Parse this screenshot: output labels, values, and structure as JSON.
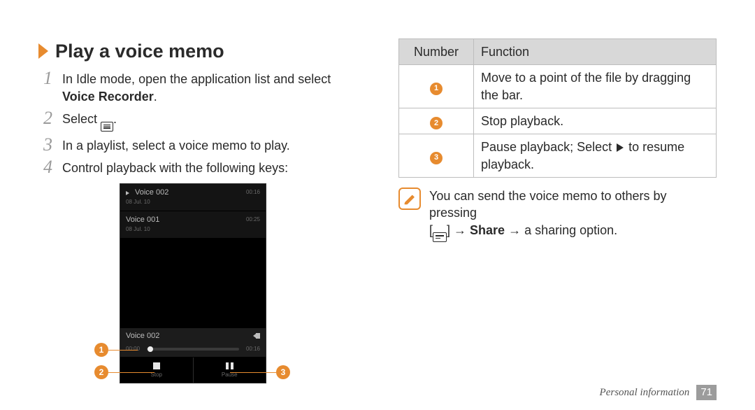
{
  "heading": "Play a voice memo",
  "steps": {
    "s1": {
      "num": "1",
      "pre": "In Idle mode, open the application list and select ",
      "bold": "Voice Recorder",
      "post": "."
    },
    "s2": {
      "num": "2",
      "pre": "Select ",
      "post": "."
    },
    "s3": {
      "num": "3",
      "text": "In a playlist, select a voice memo to play."
    },
    "s4": {
      "num": "4",
      "text": "Control playback with the following keys:"
    }
  },
  "phone": {
    "items": [
      {
        "title": "Voice 002",
        "date": "08 Jul. 10",
        "dur": "00:16"
      },
      {
        "title": "Voice 001",
        "date": "08 Jul. 10",
        "dur": "00:25"
      }
    ],
    "now_playing": {
      "title": "Voice 002",
      "elapsed": "00:00",
      "total": "00:16"
    },
    "controls": {
      "stop": "Stop",
      "pause": "Pause"
    }
  },
  "callouts": {
    "c1": "1",
    "c2": "2",
    "c3": "3"
  },
  "table": {
    "hdr_num": "Number",
    "hdr_fn": "Function",
    "rows": [
      {
        "n": "1",
        "fn": "Move to a point of the file by dragging the bar."
      },
      {
        "n": "2",
        "fn": "Stop playback."
      },
      {
        "n": "3",
        "fn_pre": "Pause playback; Select ",
        "fn_post": " to resume playback."
      }
    ]
  },
  "note": {
    "line1": "You can send the voice memo to others by pressing",
    "line2_pre": "[",
    "line2_mid1": "] → ",
    "line2_bold": "Share",
    "line2_mid2": " → a sharing option."
  },
  "footer": {
    "section": "Personal information",
    "page": "71"
  }
}
